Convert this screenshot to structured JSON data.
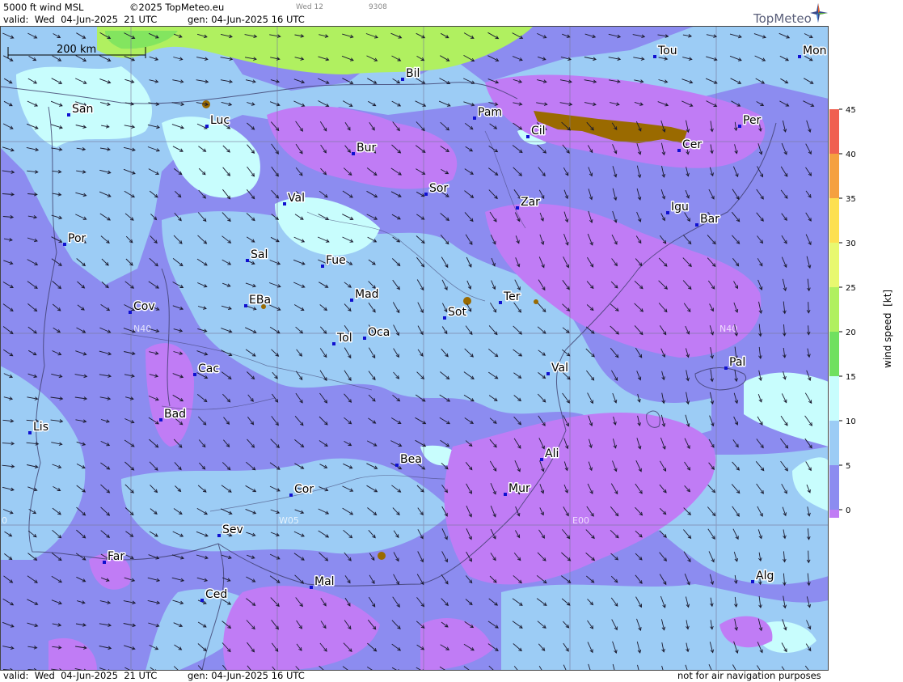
{
  "header": {
    "product": "5000 ft wind MSL",
    "copyright": "©2025 TopMeteo.eu",
    "valid": "valid:  Wed  04-Jun-2025  21 UTC",
    "generated": "gen: 04-Jun-2025 16 UTC",
    "frame_label": "Wed 12",
    "frame_code": "9308"
  },
  "footer": {
    "valid": "valid:  Wed  04-Jun-2025  21 UTC",
    "generated": "gen: 04-Jun-2025 16 UTC",
    "disclaimer": "not for air navigation purposes"
  },
  "logo": {
    "text": "TopMeteo",
    "icon": "compass-star-icon"
  },
  "scale_bar": {
    "label": "200 km"
  },
  "grid_labels": [
    "N40",
    "N40",
    "W05",
    "E00",
    "0"
  ],
  "cities": [
    "Tou",
    "Mon",
    "Bil",
    "San",
    "Luc",
    "Pam",
    "Cil",
    "Per",
    "Cer",
    "Bur",
    "Sor",
    "Zar",
    "Val",
    "Igu",
    "Bar",
    "Por",
    "Sal",
    "Fue",
    "Mad",
    "EBa",
    "Cov",
    "Sot",
    "Ter",
    "Tol",
    "Oca",
    "Cac",
    "Val",
    "Pal",
    "Bad",
    "Lis",
    "Bea",
    "Ali",
    "Mur",
    "Cor",
    "Sev",
    "Far",
    "Mal",
    "Alg",
    "Ced"
  ],
  "legend": {
    "title": "wind speed  [kt]",
    "ticks": [
      "45",
      "40",
      "35",
      "30",
      "25",
      "20",
      "15",
      "10",
      "5",
      "0"
    ],
    "colors": [
      "#f06050",
      "#f5a040",
      "#fde050",
      "#e8f870",
      "#b0f060",
      "#70e060",
      "#c8fdfd",
      "#9cccf5",
      "#8c8cf0",
      "#c07cf5"
    ]
  },
  "colors": {
    "calm": "#c07cf5",
    "light": "#8c8cf0",
    "moderate": "#9cccf5",
    "fresh": "#c8fdfd",
    "strong": "#b0f060",
    "terrain": "#9a6a00"
  }
}
